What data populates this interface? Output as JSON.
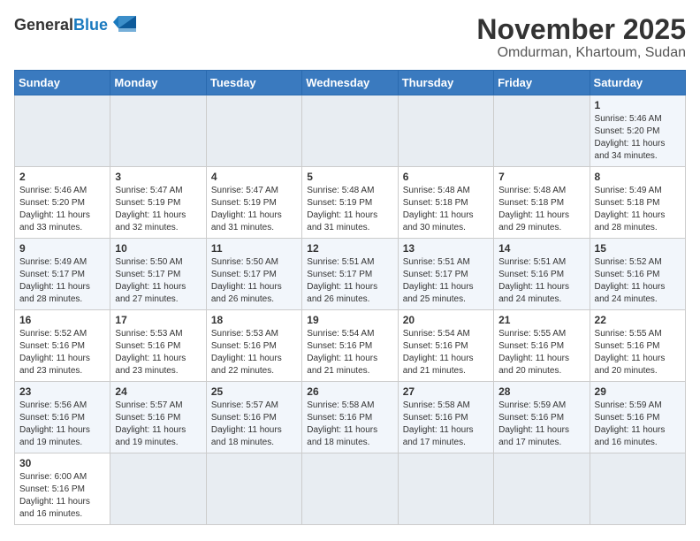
{
  "header": {
    "logo_general": "General",
    "logo_blue": "Blue",
    "month": "November 2025",
    "location": "Omdurman, Khartoum, Sudan"
  },
  "weekdays": [
    "Sunday",
    "Monday",
    "Tuesday",
    "Wednesday",
    "Thursday",
    "Friday",
    "Saturday"
  ],
  "weeks": [
    [
      {
        "day": "",
        "info": ""
      },
      {
        "day": "",
        "info": ""
      },
      {
        "day": "",
        "info": ""
      },
      {
        "day": "",
        "info": ""
      },
      {
        "day": "",
        "info": ""
      },
      {
        "day": "",
        "info": ""
      },
      {
        "day": "1",
        "info": "Sunrise: 5:46 AM\nSunset: 5:20 PM\nDaylight: 11 hours\nand 34 minutes."
      }
    ],
    [
      {
        "day": "2",
        "info": "Sunrise: 5:46 AM\nSunset: 5:20 PM\nDaylight: 11 hours\nand 33 minutes."
      },
      {
        "day": "3",
        "info": "Sunrise: 5:47 AM\nSunset: 5:19 PM\nDaylight: 11 hours\nand 32 minutes."
      },
      {
        "day": "4",
        "info": "Sunrise: 5:47 AM\nSunset: 5:19 PM\nDaylight: 11 hours\nand 31 minutes."
      },
      {
        "day": "5",
        "info": "Sunrise: 5:48 AM\nSunset: 5:19 PM\nDaylight: 11 hours\nand 31 minutes."
      },
      {
        "day": "6",
        "info": "Sunrise: 5:48 AM\nSunset: 5:18 PM\nDaylight: 11 hours\nand 30 minutes."
      },
      {
        "day": "7",
        "info": "Sunrise: 5:48 AM\nSunset: 5:18 PM\nDaylight: 11 hours\nand 29 minutes."
      },
      {
        "day": "8",
        "info": "Sunrise: 5:49 AM\nSunset: 5:18 PM\nDaylight: 11 hours\nand 28 minutes."
      }
    ],
    [
      {
        "day": "9",
        "info": "Sunrise: 5:49 AM\nSunset: 5:17 PM\nDaylight: 11 hours\nand 28 minutes."
      },
      {
        "day": "10",
        "info": "Sunrise: 5:50 AM\nSunset: 5:17 PM\nDaylight: 11 hours\nand 27 minutes."
      },
      {
        "day": "11",
        "info": "Sunrise: 5:50 AM\nSunset: 5:17 PM\nDaylight: 11 hours\nand 26 minutes."
      },
      {
        "day": "12",
        "info": "Sunrise: 5:51 AM\nSunset: 5:17 PM\nDaylight: 11 hours\nand 26 minutes."
      },
      {
        "day": "13",
        "info": "Sunrise: 5:51 AM\nSunset: 5:17 PM\nDaylight: 11 hours\nand 25 minutes."
      },
      {
        "day": "14",
        "info": "Sunrise: 5:51 AM\nSunset: 5:16 PM\nDaylight: 11 hours\nand 24 minutes."
      },
      {
        "day": "15",
        "info": "Sunrise: 5:52 AM\nSunset: 5:16 PM\nDaylight: 11 hours\nand 24 minutes."
      }
    ],
    [
      {
        "day": "16",
        "info": "Sunrise: 5:52 AM\nSunset: 5:16 PM\nDaylight: 11 hours\nand 23 minutes."
      },
      {
        "day": "17",
        "info": "Sunrise: 5:53 AM\nSunset: 5:16 PM\nDaylight: 11 hours\nand 23 minutes."
      },
      {
        "day": "18",
        "info": "Sunrise: 5:53 AM\nSunset: 5:16 PM\nDaylight: 11 hours\nand 22 minutes."
      },
      {
        "day": "19",
        "info": "Sunrise: 5:54 AM\nSunset: 5:16 PM\nDaylight: 11 hours\nand 21 minutes."
      },
      {
        "day": "20",
        "info": "Sunrise: 5:54 AM\nSunset: 5:16 PM\nDaylight: 11 hours\nand 21 minutes."
      },
      {
        "day": "21",
        "info": "Sunrise: 5:55 AM\nSunset: 5:16 PM\nDaylight: 11 hours\nand 20 minutes."
      },
      {
        "day": "22",
        "info": "Sunrise: 5:55 AM\nSunset: 5:16 PM\nDaylight: 11 hours\nand 20 minutes."
      }
    ],
    [
      {
        "day": "23",
        "info": "Sunrise: 5:56 AM\nSunset: 5:16 PM\nDaylight: 11 hours\nand 19 minutes."
      },
      {
        "day": "24",
        "info": "Sunrise: 5:57 AM\nSunset: 5:16 PM\nDaylight: 11 hours\nand 19 minutes."
      },
      {
        "day": "25",
        "info": "Sunrise: 5:57 AM\nSunset: 5:16 PM\nDaylight: 11 hours\nand 18 minutes."
      },
      {
        "day": "26",
        "info": "Sunrise: 5:58 AM\nSunset: 5:16 PM\nDaylight: 11 hours\nand 18 minutes."
      },
      {
        "day": "27",
        "info": "Sunrise: 5:58 AM\nSunset: 5:16 PM\nDaylight: 11 hours\nand 17 minutes."
      },
      {
        "day": "28",
        "info": "Sunrise: 5:59 AM\nSunset: 5:16 PM\nDaylight: 11 hours\nand 17 minutes."
      },
      {
        "day": "29",
        "info": "Sunrise: 5:59 AM\nSunset: 5:16 PM\nDaylight: 11 hours\nand 16 minutes."
      }
    ],
    [
      {
        "day": "30",
        "info": "Sunrise: 6:00 AM\nSunset: 5:16 PM\nDaylight: 11 hours\nand 16 minutes."
      },
      {
        "day": "",
        "info": ""
      },
      {
        "day": "",
        "info": ""
      },
      {
        "day": "",
        "info": ""
      },
      {
        "day": "",
        "info": ""
      },
      {
        "day": "",
        "info": ""
      },
      {
        "day": "",
        "info": ""
      }
    ]
  ]
}
